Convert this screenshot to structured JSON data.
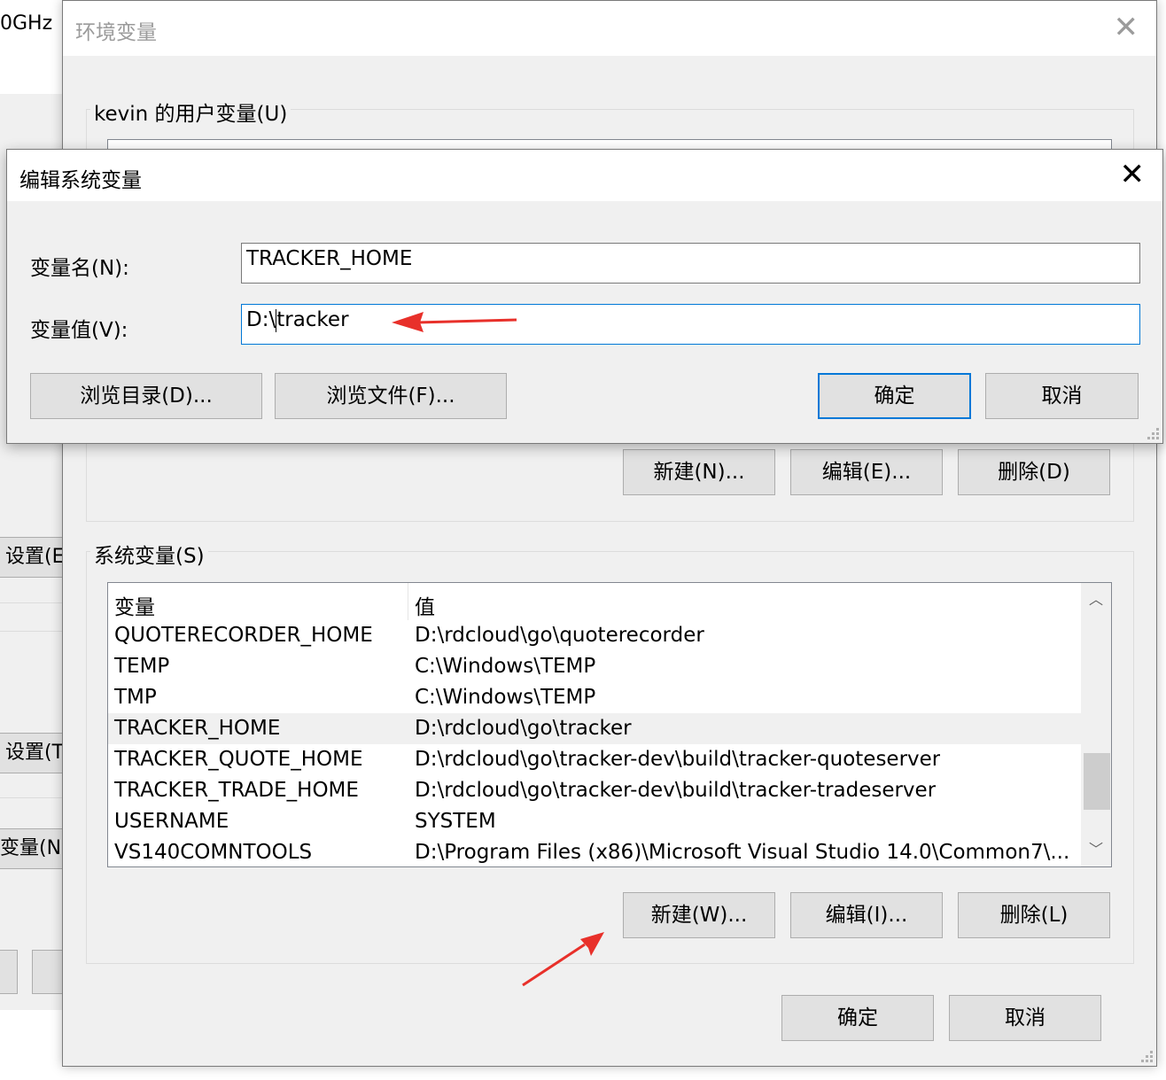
{
  "background_window": {
    "cpu_text": "0GHz",
    "buttons": [
      "设置(E",
      "设置(T",
      "变量(N)"
    ]
  },
  "env_window": {
    "title": "环境变量",
    "user_group": {
      "label": "kevin 的用户变量(U)",
      "buttons": {
        "new": "新建(N)...",
        "edit": "编辑(E)...",
        "delete": "删除(D)"
      }
    },
    "system_group": {
      "label": "系统变量(S)",
      "columns": {
        "name": "变量",
        "value": "值"
      },
      "rows": [
        {
          "name": "QUOTERECORDER_HOME",
          "value": "D:\\rdcloud\\go\\quoterecorder"
        },
        {
          "name": "TEMP",
          "value": "C:\\Windows\\TEMP"
        },
        {
          "name": "TMP",
          "value": "C:\\Windows\\TEMP"
        },
        {
          "name": "TRACKER_HOME",
          "value": "D:\\rdcloud\\go\\tracker"
        },
        {
          "name": "TRACKER_QUOTE_HOME",
          "value": "D:\\rdcloud\\go\\tracker-dev\\build\\tracker-quoteserver"
        },
        {
          "name": "TRACKER_TRADE_HOME",
          "value": "D:\\rdcloud\\go\\tracker-dev\\build\\tracker-tradeserver"
        },
        {
          "name": "USERNAME",
          "value": "SYSTEM"
        },
        {
          "name": "VS140COMNTOOLS",
          "value": "D:\\Program Files (x86)\\Microsoft Visual Studio 14.0\\Common7\\..."
        }
      ],
      "selected_row": "TRACKER_HOME",
      "buttons": {
        "new": "新建(W)...",
        "edit": "编辑(I)...",
        "delete": "删除(L)"
      }
    },
    "footer_buttons": {
      "ok": "确定",
      "cancel": "取消"
    }
  },
  "edit_dialog": {
    "title": "编辑系统变量",
    "name_label": "变量名(N):",
    "name_value": "TRACKER_HOME",
    "value_label": "变量值(V):",
    "value_before_caret": "D:\\",
    "value_after_caret": "tracker",
    "buttons": {
      "browse_dir": "浏览目录(D)...",
      "browse_file": "浏览文件(F)...",
      "ok": "确定",
      "cancel": "取消"
    }
  },
  "colors": {
    "focus_accent": "#0078d7",
    "annotation": "#e8302a"
  }
}
